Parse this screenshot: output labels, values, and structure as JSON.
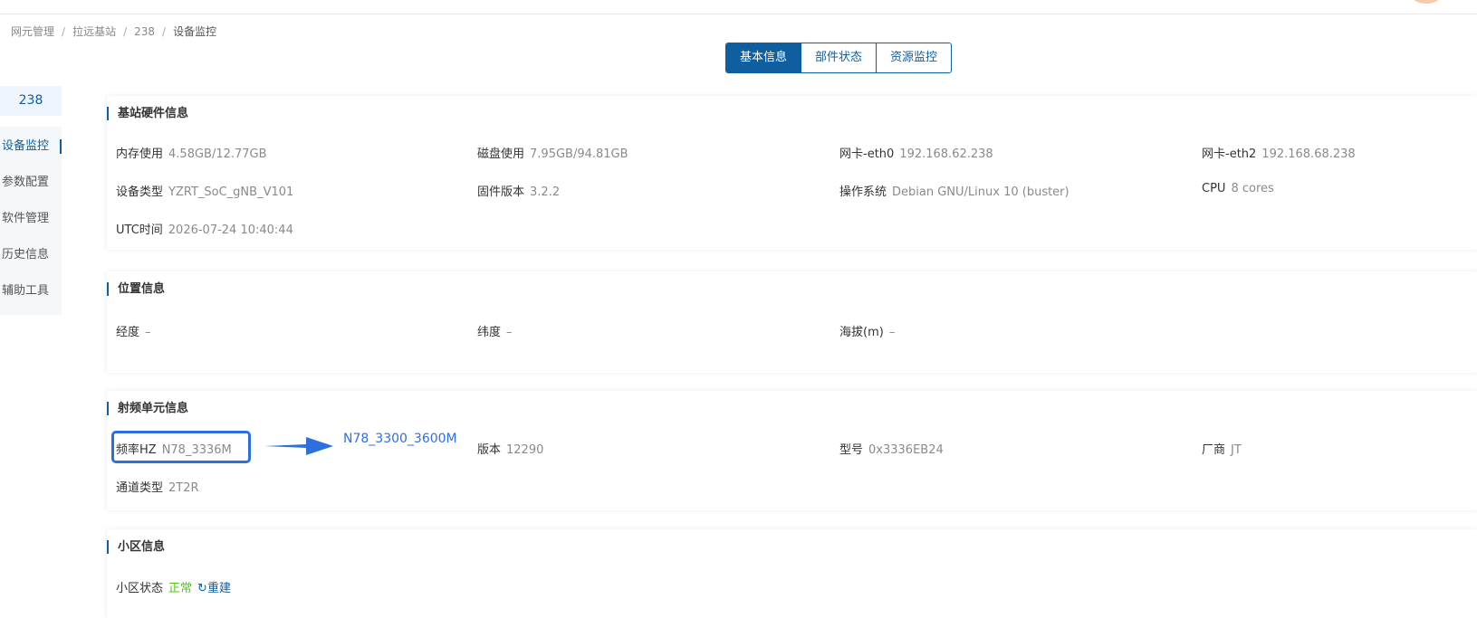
{
  "breadcrumb": [
    "网元管理",
    "拉远基站",
    "238",
    "设备监控"
  ],
  "tabs": [
    {
      "label": "基本信息",
      "active": true
    },
    {
      "label": "部件状态",
      "active": false
    },
    {
      "label": "资源监控",
      "active": false
    }
  ],
  "sidebar": {
    "device_id": "238",
    "items": [
      {
        "label": "设备监控",
        "active": true
      },
      {
        "label": "参数配置",
        "active": false
      },
      {
        "label": "软件管理",
        "active": false
      },
      {
        "label": "历史信息",
        "active": false
      },
      {
        "label": "辅助工具",
        "active": false
      }
    ]
  },
  "hardware": {
    "title": "基站硬件信息",
    "fields": [
      {
        "label": "内存使用",
        "value": "4.58GB/12.77GB"
      },
      {
        "label": "磁盘使用",
        "value": "7.95GB/94.81GB"
      },
      {
        "label": "网卡-eth0",
        "value": "192.168.62.238"
      },
      {
        "label": "网卡-eth2",
        "value": "192.168.68.238"
      },
      {
        "label": "设备类型",
        "value": "YZRT_SoC_gNB_V101"
      },
      {
        "label": "固件版本",
        "value": "3.2.2"
      },
      {
        "label": "操作系统",
        "value": "Debian GNU/Linux 10 (buster)"
      },
      {
        "label": "CPU",
        "value": "8 cores"
      },
      {
        "label": "UTC时间",
        "value": "2026-07-24 10:40:44"
      }
    ]
  },
  "location": {
    "title": "位置信息",
    "fields": [
      {
        "label": "经度",
        "value": "–"
      },
      {
        "label": "纬度",
        "value": "–"
      },
      {
        "label": "海拔(m)",
        "value": "–"
      }
    ]
  },
  "rf": {
    "title": "射频单元信息",
    "fields": [
      {
        "label": "频率HZ",
        "value": "N78_3336M"
      },
      {
        "label": "版本",
        "value": "12290"
      },
      {
        "label": "型号",
        "value": "0x3336EB24"
      },
      {
        "label": "厂商",
        "value": "JT"
      },
      {
        "label": "通道类型",
        "value": "2T2R"
      }
    ],
    "annotation": "N78_3300_3600M"
  },
  "cell": {
    "title": "小区信息",
    "status_label": "小区状态",
    "status_value": "正常",
    "rebuild_label": "重建"
  },
  "colors": {
    "primary": "#0f5fa0",
    "annotation": "#2e6fe0",
    "status_ok": "#52c41a"
  }
}
